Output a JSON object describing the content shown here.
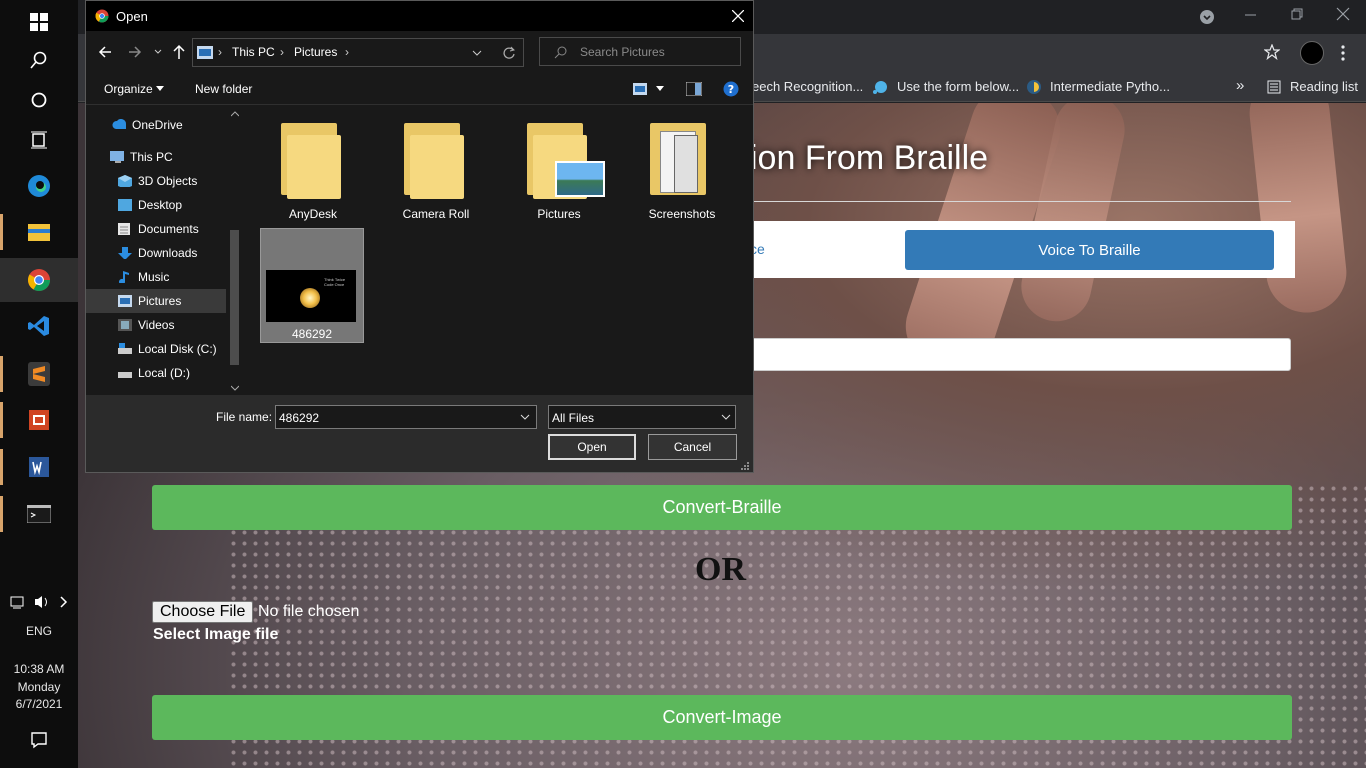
{
  "taskbar": {
    "language": "ENG",
    "time": "10:38 AM",
    "day": "Monday",
    "date": "6/7/2021"
  },
  "browser": {
    "reading_list": "Reading list",
    "bookmarks": [
      {
        "label": "eech Recognition..."
      },
      {
        "label": "Use the form below..."
      },
      {
        "label": "Intermediate Pytho..."
      }
    ]
  },
  "page": {
    "heading": "ion From Braille",
    "tab_left": "ce",
    "voice_to_braille": "Voice To Braille",
    "convert_braille": "Convert-Braille",
    "or_text": "OR",
    "choose_file": "Choose File",
    "no_file": "No file chosen",
    "select_image": "Select Image file",
    "convert_image": "Convert-Image"
  },
  "dialog": {
    "title": "Open",
    "breadcrumb": [
      "This PC",
      "Pictures"
    ],
    "search_placeholder": "Search Pictures",
    "organize": "Organize",
    "new_folder": "New folder",
    "tree": [
      {
        "label": "OneDrive"
      },
      {
        "label": "This PC"
      },
      {
        "label": "3D Objects"
      },
      {
        "label": "Desktop"
      },
      {
        "label": "Documents"
      },
      {
        "label": "Downloads"
      },
      {
        "label": "Music"
      },
      {
        "label": "Pictures"
      },
      {
        "label": "Videos"
      },
      {
        "label": "Local Disk (C:)"
      },
      {
        "label": "Local (D:)"
      }
    ],
    "files": [
      {
        "label": "AnyDesk"
      },
      {
        "label": "Camera Roll"
      },
      {
        "label": "Pictures"
      },
      {
        "label": "Screenshots"
      },
      {
        "label": "486292"
      }
    ],
    "thumb_caption": "Think Twice Code Once",
    "filename_label": "File name:",
    "filename_value": "486292",
    "filetype_value": "All Files",
    "open_button": "Open",
    "cancel_button": "Cancel"
  },
  "colors": {
    "accent_green": "#5cb85c",
    "accent_blue": "#337ab7",
    "folder_yellow": "#f6d980"
  }
}
